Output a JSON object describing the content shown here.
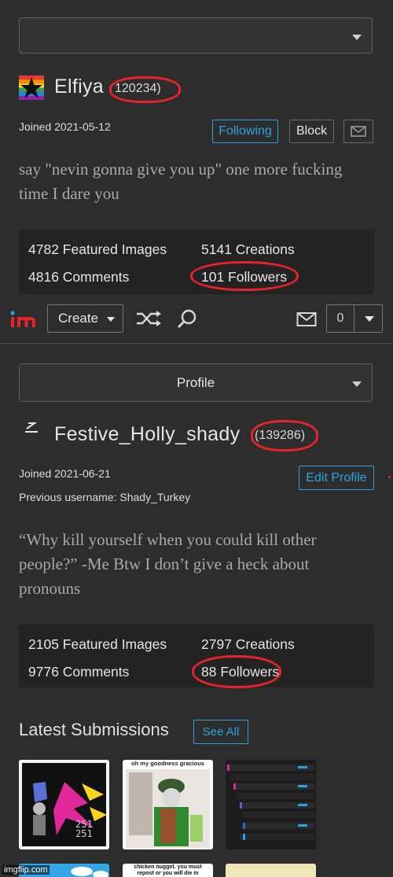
{
  "top_profile": {
    "dropdown_value": "",
    "username": "Elfiya",
    "points": "120234)",
    "joined": "Joined 2021-05-12",
    "following_label": "Following",
    "block_label": "Block",
    "bio": "say \"nevin gonna give you up\" one more fucking time I dare you",
    "stats": {
      "featured": "4782 Featured Images",
      "creations": "5141 Creations",
      "comments": "4816 Comments",
      "followers": "101 Followers"
    }
  },
  "navbar": {
    "create_label": "Create",
    "notification_count": "0"
  },
  "profile": {
    "dropdown_value": "Profile",
    "username": "Festive_Holly_shady",
    "points": "(139286)",
    "joined": "Joined 2021-06-21",
    "previous_username": "Previous username: Shady_Turkey",
    "edit_label": "Edit Profile",
    "bio": "“Why kill yourself when you could kill other people?” -Me Btw I don’t give a heck about pronouns",
    "stats": {
      "featured": "2105 Featured Images",
      "creations": "2797 Creations",
      "comments": "9776 Comments",
      "followers": "88 Followers"
    }
  },
  "latest": {
    "title": "Latest Submissions",
    "see_all": "See All",
    "thumb2_caption": "oh my goodness gracious",
    "thumb5_caption": "chicken nugget. you must repost or you will die in"
  },
  "watermark": "imgflip.com",
  "colors": {
    "accent_blue": "#2aa3e0",
    "annotation_red": "#e8232a",
    "background": "#2d2d2d"
  }
}
